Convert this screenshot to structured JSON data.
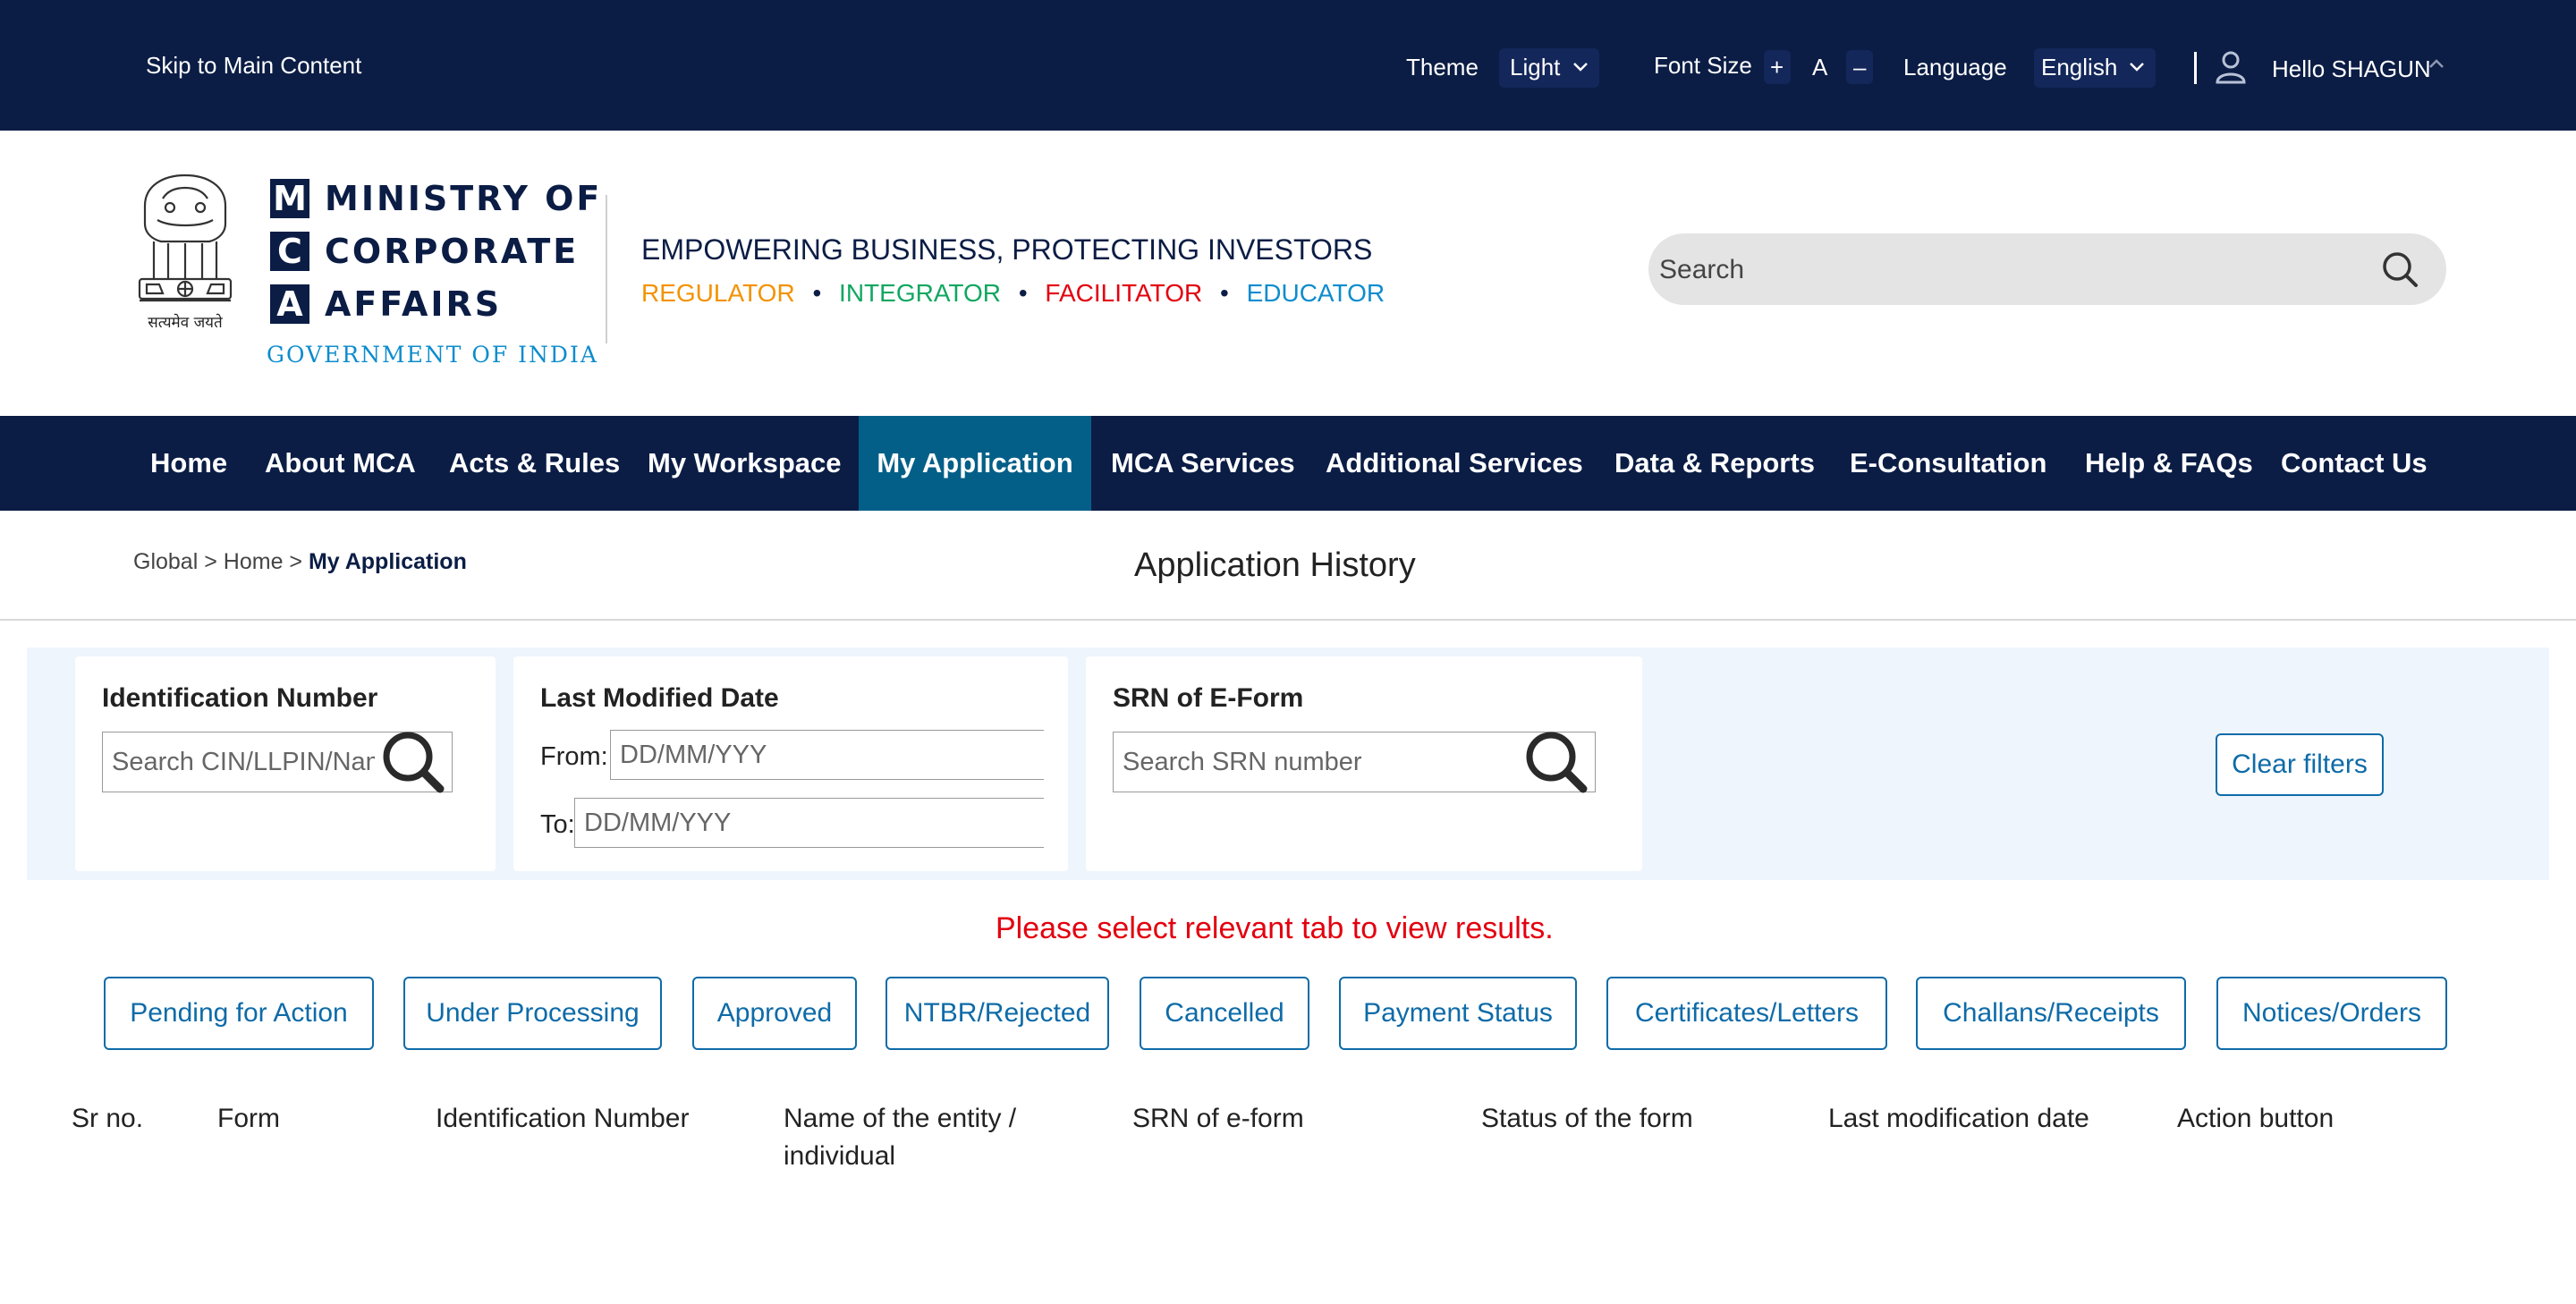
{
  "topbar": {
    "skip_link": "Skip to Main Content",
    "theme_label": "Theme",
    "theme_value": "Light",
    "font_size_label": "Font Size",
    "font_increase": "+",
    "font_normal": "A",
    "font_decrease": "–",
    "language_label": "Language",
    "language_value": "English",
    "greeting": "Hello SHAGUN"
  },
  "header": {
    "mca_letters": [
      "M",
      "C",
      "A"
    ],
    "mca_words": [
      "MINISTRY OF",
      "CORPORATE",
      "AFFAIRS"
    ],
    "gov": "GOVERNMENT OF INDIA",
    "emblem_motto": "सत्यमेव जयते",
    "tagline": "EMPOWERING BUSINESS, PROTECTING INVESTORS",
    "roles": [
      {
        "label": "REGULATOR",
        "color": "#f39200"
      },
      {
        "label": "INTEGRATOR",
        "color": "#10a760"
      },
      {
        "label": "FACILITATOR",
        "color": "#e3000f"
      },
      {
        "label": "EDUCATOR",
        "color": "#0d8ccd"
      }
    ],
    "search_placeholder": "Search"
  },
  "nav": {
    "items": [
      "Home",
      "About MCA",
      "Acts & Rules",
      "My Workspace",
      "My Application",
      "MCA Services",
      "Additional Services",
      "Data & Reports",
      "E-Consultation",
      "Help & FAQs",
      "Contact Us"
    ],
    "active": "My Application"
  },
  "breadcrumb": {
    "items": [
      "Global",
      "Home",
      "My Application"
    ],
    "separator": ">"
  },
  "page_title": "Application History",
  "filters": {
    "identification": {
      "label": "Identification Number",
      "placeholder": "Search CIN/LLPIN/Name"
    },
    "last_modified": {
      "label": "Last Modified Date",
      "from_label": "From:",
      "to_label": "To:",
      "from_placeholder": "DD/MM/YYY",
      "to_placeholder": "DD/MM/YYY"
    },
    "srn": {
      "label": "SRN of E-Form",
      "placeholder": "Search SRN number"
    },
    "clear_label": "Clear filters"
  },
  "notice": "Please select relevant tab to view results.",
  "tabs": [
    "Pending for Action",
    "Under Processing",
    "Approved",
    "NTBR/Rejected",
    "Cancelled",
    "Payment Status",
    "Certificates/Letters",
    "Challans/Receipts",
    "Notices/Orders"
  ],
  "table": {
    "columns": [
      "Sr no.",
      "Form",
      "Identification Number",
      "Name of the entity / individual",
      "SRN of e-form",
      "Status of the form",
      "Last modification date",
      "Action button"
    ]
  },
  "colors": {
    "navy": "#0b1d45",
    "active_nav": "#045f88",
    "accent_blue": "#0e6ba8",
    "notice_red": "#e3000f",
    "filter_band": "#eef5fc"
  }
}
